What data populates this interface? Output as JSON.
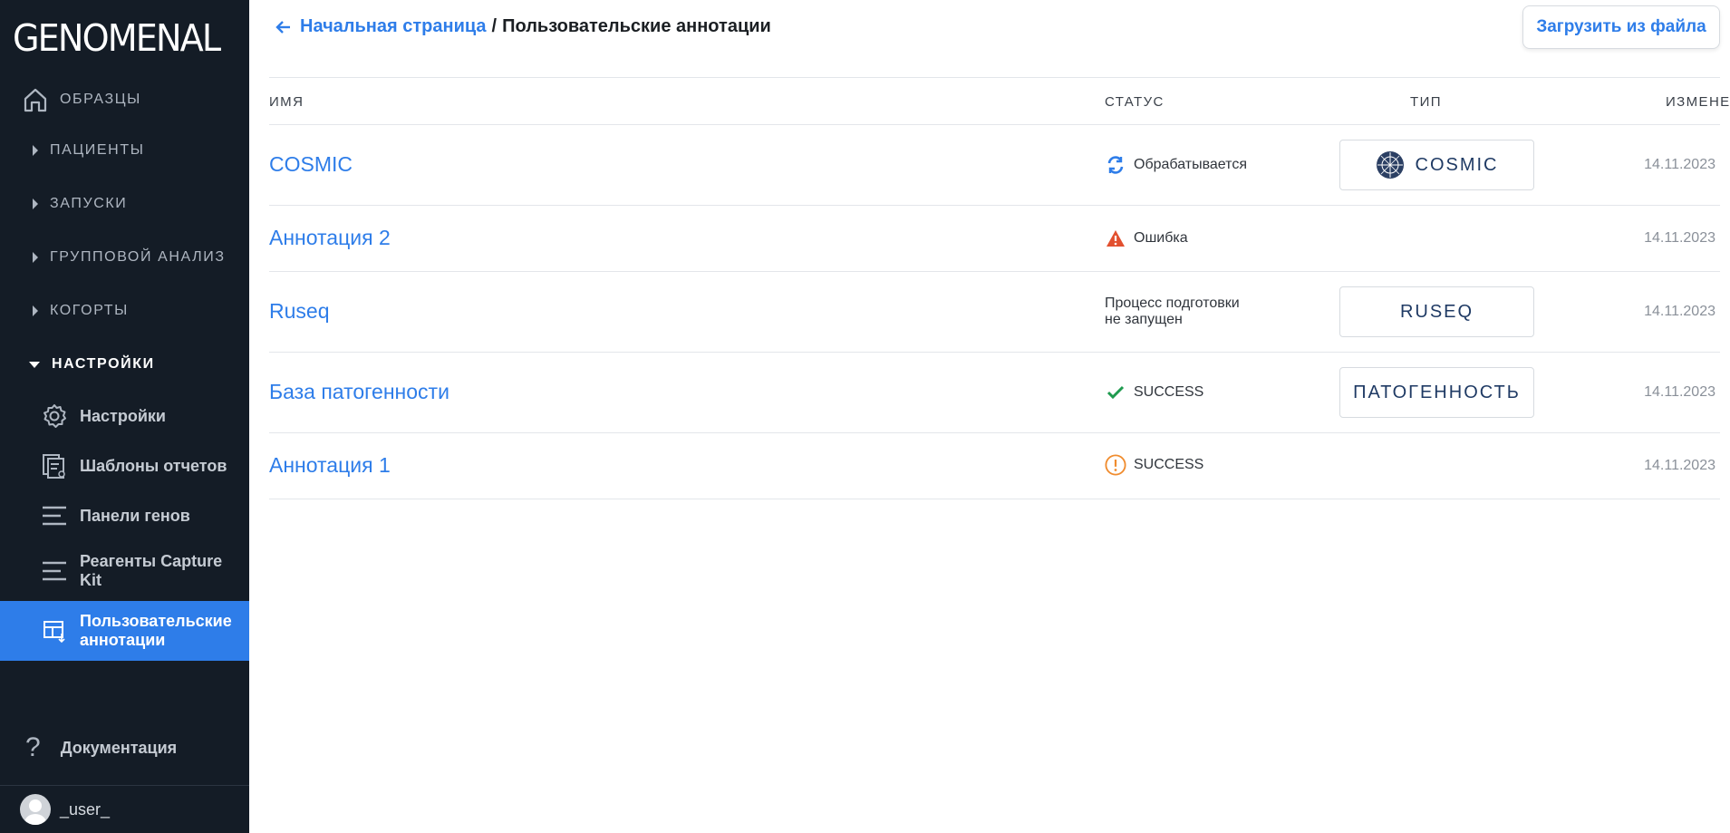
{
  "app": {
    "logo": "GENOMENAL"
  },
  "sidebar": {
    "home": {
      "label": "ОБРАЗЦЫ",
      "icon": "home-icon"
    },
    "sections": [
      {
        "label": "ПАЦИЕНТЫ"
      },
      {
        "label": "ЗАПУСКИ"
      },
      {
        "label": "ГРУППОВОЙ АНАЛИЗ"
      },
      {
        "label": "КОГОРТЫ"
      }
    ],
    "settings_section": {
      "label": "НАСТРОЙКИ"
    },
    "settings_items": [
      {
        "label": "Настройки",
        "icon": "gear-icon"
      },
      {
        "label": "Шаблоны отчетов",
        "icon": "report-template-icon"
      },
      {
        "label": "Панели генов",
        "icon": "lines-icon"
      },
      {
        "label": "Реагенты Capture Kit",
        "icon": "lines-icon"
      },
      {
        "label": "Пользовательские аннотации",
        "icon": "table-icon",
        "active": true
      }
    ],
    "docs": {
      "label": "Документация",
      "icon": "question-icon"
    },
    "user": {
      "label": "_user_"
    }
  },
  "header": {
    "back_label": "Начальная страница",
    "separator": "/",
    "current": "Пользовательские аннотации",
    "upload_button": "Загрузить из файла"
  },
  "table": {
    "columns": [
      "ИМЯ",
      "СТАТУС",
      "ТИП",
      "ИЗМЕНЕН"
    ],
    "rows": [
      {
        "name": "COSMIC",
        "status": "Обрабатывается",
        "status_icon": "refresh-icon",
        "type": "COSMIC",
        "type_logo": "cosmic-logo-icon",
        "date": "14.11.2023"
      },
      {
        "name": "Аннотация 2",
        "status": "Ошибка",
        "status_icon": "warning-icon",
        "type": "",
        "date": "14.11.2023"
      },
      {
        "name": "Ruseq",
        "status_line1": "Процесс подготовки",
        "status_line2": "не запущен",
        "type": "RUSEQ",
        "date": "14.11.2023"
      },
      {
        "name": "База патогенности",
        "status": "SUCCESS",
        "status_icon": "check-icon",
        "type": "ПАТОГЕННОСТЬ",
        "date": "14.11.2023"
      },
      {
        "name": "Аннотация 1",
        "status": "SUCCESS",
        "status_icon": "exclamation-circle-icon",
        "type": "",
        "date": "14.11.2023"
      }
    ]
  },
  "colors": {
    "accent": "#2e7de9",
    "sidebar_bg": "#141c26",
    "error": "#e2502f",
    "success": "#1f9b4f",
    "warning": "#f08c2e"
  }
}
